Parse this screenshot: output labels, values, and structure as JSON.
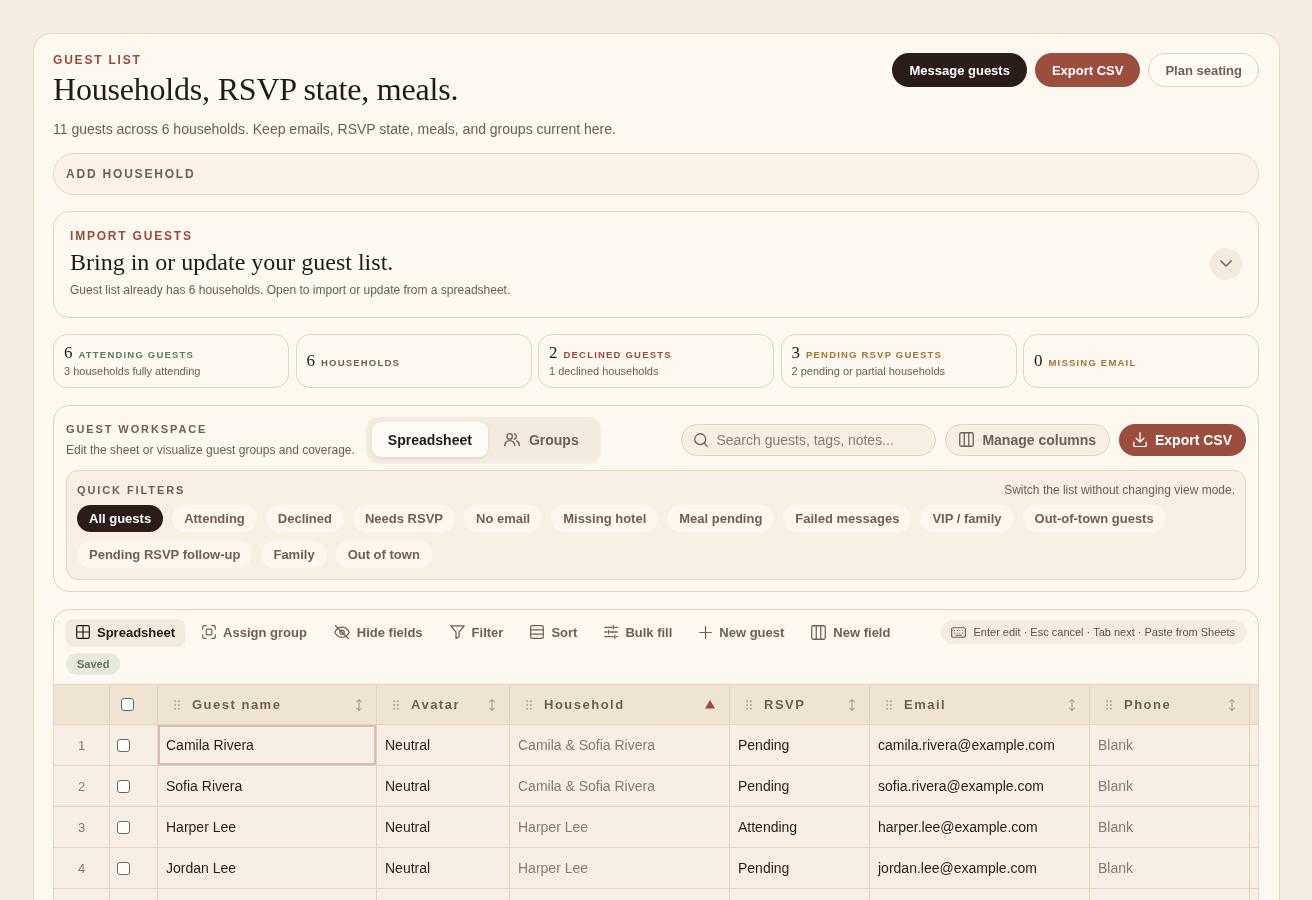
{
  "header": {
    "eyebrow": "GUEST LIST",
    "title": "Households, RSVP state, meals.",
    "subtitle": "11 guests across 6 households. Keep emails, RSVP state, meals, and groups current here.",
    "buttons": [
      {
        "label": "Message guests",
        "kind": "dark"
      },
      {
        "label": "Export CSV",
        "kind": "accent"
      },
      {
        "label": "Plan seating",
        "kind": "outline"
      }
    ]
  },
  "add_household": {
    "label": "ADD HOUSEHOLD"
  },
  "import": {
    "eyebrow": "IMPORT GUESTS",
    "title": "Bring in or update your guest list.",
    "description": "Guest list already has 6 households. Open to import or update from a spreadsheet.",
    "expanded": false
  },
  "stats": [
    {
      "value": "6",
      "label": "ATTENDING GUESTS",
      "note": "3 households fully attending",
      "color": "#5b7b5e"
    },
    {
      "value": "6",
      "label": "HOUSEHOLDS",
      "color": "#6f5f55"
    },
    {
      "value": "2",
      "label": "DECLINED GUESTS",
      "note": "1 declined households",
      "color": "#a0473b"
    },
    {
      "value": "3",
      "label": "PENDING RSVP GUESTS",
      "note": "2 pending or partial households",
      "color": "#a87232"
    },
    {
      "value": "0",
      "label": "MISSING EMAIL",
      "color": "#a87232"
    }
  ],
  "workspace": {
    "eyebrow": "GUEST WORKSPACE",
    "description": "Edit the sheet or visualize guest groups and coverage.",
    "views": [
      {
        "label": "Spreadsheet",
        "selected": true
      },
      {
        "label": "Groups",
        "selected": false
      }
    ],
    "search": {
      "placeholder": "Search guests, tags, notes..."
    },
    "buttons": [
      {
        "label": "Manage columns",
        "kind": "soft"
      },
      {
        "label": "Export CSV",
        "kind": "accent"
      }
    ],
    "quick_filters": {
      "title": "QUICK FILTERS",
      "hint": "Switch the list without changing view mode.",
      "chips": [
        {
          "label": "All guests",
          "selected": true
        },
        {
          "label": "Attending",
          "selected": false
        },
        {
          "label": "Declined",
          "selected": false
        },
        {
          "label": "Needs RSVP",
          "selected": false
        },
        {
          "label": "No email",
          "selected": false
        },
        {
          "label": "Missing hotel",
          "selected": false
        },
        {
          "label": "Meal pending",
          "selected": false
        },
        {
          "label": "Failed messages",
          "selected": false
        },
        {
          "label": "VIP / family",
          "selected": false
        },
        {
          "label": "Out-of-town guests",
          "selected": false
        },
        {
          "label": "Pending RSVP follow-up",
          "selected": false
        },
        {
          "label": "Family",
          "selected": false
        },
        {
          "label": "Out of town",
          "selected": false
        }
      ]
    }
  },
  "sheet": {
    "tools": [
      {
        "label": "Spreadsheet",
        "selected": true
      },
      {
        "label": "Assign group",
        "selected": false
      },
      {
        "label": "Hide fields",
        "selected": false
      },
      {
        "label": "Filter",
        "selected": false
      },
      {
        "label": "Sort",
        "selected": false
      },
      {
        "label": "Bulk fill",
        "selected": false
      },
      {
        "label": "New guest",
        "selected": false
      },
      {
        "label": "New field",
        "selected": false
      }
    ],
    "shortcuts": "Enter edit · Esc cancel · Tab next · Paste from Sheets",
    "save_status": "Saved",
    "header_checkbox": {
      "checked": false
    },
    "columns": [
      {
        "label": "Guest name",
        "sorted": false,
        "muted": false
      },
      {
        "label": "Avatar",
        "sorted": false,
        "muted": false
      },
      {
        "label": "Household",
        "sorted": true,
        "muted": true
      },
      {
        "label": "RSVP",
        "sorted": false,
        "muted": false
      },
      {
        "label": "Email",
        "sorted": false,
        "muted": false
      },
      {
        "label": "Phone",
        "sorted": false,
        "muted": true
      }
    ],
    "rows": [
      {
        "number": "1",
        "checked": false,
        "focused": true,
        "cells": [
          "Camila Rivera",
          "Neutral",
          "Camila & Sofia Rivera",
          "Pending",
          "camila.rivera@example.com",
          "Blank"
        ]
      },
      {
        "number": "2",
        "checked": false,
        "focused": false,
        "cells": [
          "Sofia Rivera",
          "Neutral",
          "Camila & Sofia Rivera",
          "Pending",
          "sofia.rivera@example.com",
          "Blank"
        ]
      },
      {
        "number": "3",
        "checked": false,
        "focused": false,
        "cells": [
          "Harper Lee",
          "Neutral",
          "Harper Lee",
          "Attending",
          "harper.lee@example.com",
          "Blank"
        ]
      },
      {
        "number": "4",
        "checked": false,
        "focused": false,
        "cells": [
          "Jordan Lee",
          "Neutral",
          "Harper Lee",
          "Pending",
          "jordan.lee@example.com",
          "Blank"
        ]
      }
    ]
  }
}
